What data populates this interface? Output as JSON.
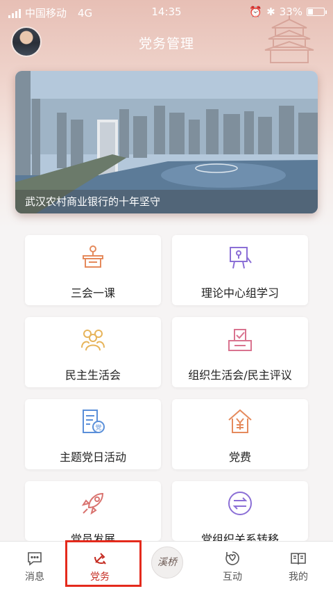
{
  "status_bar": {
    "carrier": "中国移动",
    "network": "4G",
    "time": "14:35",
    "battery": "33%"
  },
  "header": {
    "title": "党务管理",
    "avatar_icon": "user-avatar"
  },
  "banner": {
    "caption": "武汉农村商业银行的十年坚守"
  },
  "cards": [
    {
      "label": "三会一课",
      "icon": "podium-icon",
      "color": "#e58a5c"
    },
    {
      "label": "理论中心组学习",
      "icon": "presentation-board-icon",
      "color": "#8b6fd6"
    },
    {
      "label": "民主生活会",
      "icon": "group-people-icon",
      "color": "#e7b45a"
    },
    {
      "label": "组织生活会/民主评议",
      "icon": "ballot-box-icon",
      "color": "#d9738f"
    },
    {
      "label": "主题党日活动",
      "icon": "party-document-icon",
      "color": "#5a8fd9"
    },
    {
      "label": "党费",
      "icon": "yuan-house-icon",
      "color": "#e58a5c"
    },
    {
      "label": "党员发展",
      "icon": "rocket-icon",
      "color": "#d9736f"
    },
    {
      "label": "党组织关系转移",
      "icon": "transfer-arrows-icon",
      "color": "#8b6fd6"
    }
  ],
  "tabbar": {
    "items": [
      {
        "label": "消息",
        "icon": "message-icon"
      },
      {
        "label": "党务",
        "icon": "party-emblem-icon"
      },
      {
        "label": "互动",
        "icon": "interaction-icon"
      },
      {
        "label": "我的",
        "icon": "book-icon"
      }
    ],
    "center_logo": "溪桥",
    "active_color": "#c52c22",
    "highlight_color": "#e42a1c"
  }
}
